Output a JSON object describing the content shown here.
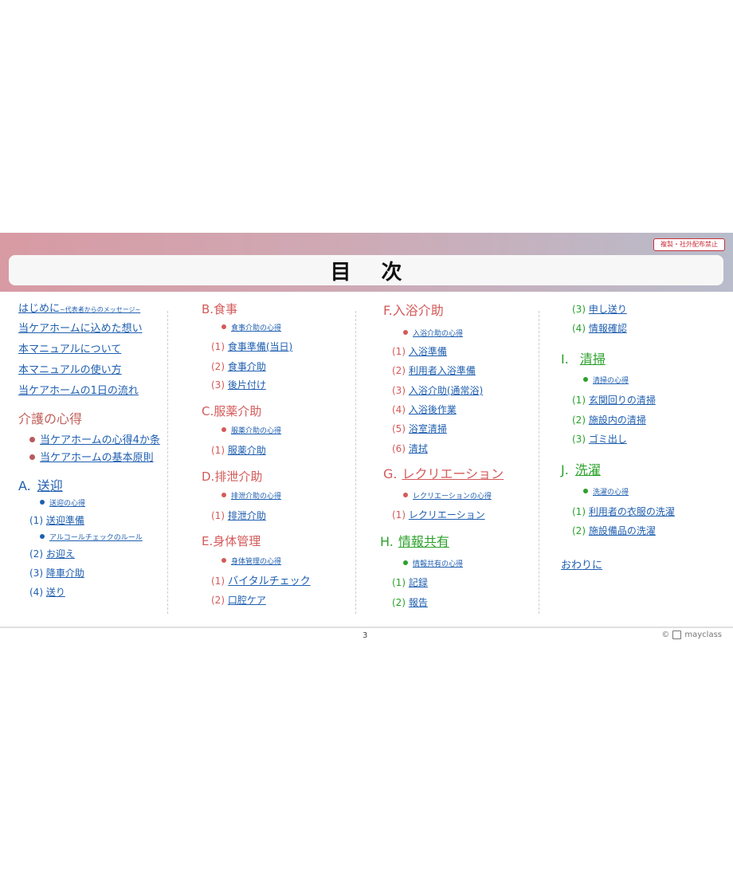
{
  "notice": "複製・社外配布禁止",
  "title": "目次",
  "col1": {
    "intro": "はじめに",
    "intro_sub": "~代表者からのメッセージ~",
    "links": [
      "当ケアホームに込めた想い",
      "本マニュアルについて",
      "本マニュアルの使い方",
      "当ケアホームの1日の流れ"
    ],
    "kaigo_title": "介護の心得",
    "kaigo_items": [
      "当ケアホームの心得4か条",
      "当ケアホームの基本原則"
    ],
    "a_letter": "A.",
    "a_title": "送迎",
    "a_heart": "送迎の心得",
    "a_1_num": "(1)",
    "a_1": "送迎準備",
    "a_alcohol": "アルコールチェックのルール",
    "a_2_num": "(2)",
    "a_2": "お迎え",
    "a_3_num": "(3)",
    "a_3": "降車介助",
    "a_4_num": "(4)",
    "a_4": "送り"
  },
  "col2": {
    "b_title": "B.食事",
    "b_heart": "食事介助の心得",
    "b_1_num": "(1)",
    "b_1": "食事準備(当日)",
    "b_2_num": "(2)",
    "b_2": "食事介助",
    "b_3_num": "(3)",
    "b_3": "後片付け",
    "c_title": "C.服薬介助",
    "c_heart": "服薬介助の心得",
    "c_1_num": "(1)",
    "c_1": "服薬介助",
    "d_title": "D.排泄介助",
    "d_heart": "排泄介助の心得",
    "d_1_num": "(1)",
    "d_1": "排泄介助",
    "e_title": "E.身体管理",
    "e_heart": "身体管理の心得",
    "e_1_num": "(1)",
    "e_1": "バイタルチェック",
    "e_2_num": "(2)",
    "e_2": "口腔ケア"
  },
  "col3": {
    "f_title": "F.入浴介助",
    "f_heart": "入浴介助の心得",
    "f_1_num": "(1)",
    "f_1": "入浴準備",
    "f_2_num": "(2)",
    "f_2": "利用者入浴準備",
    "f_3_num": "(3)",
    "f_3": "入浴介助(通常浴)",
    "f_4_num": "(4)",
    "f_4": "入浴後作業",
    "f_5_num": "(5)",
    "f_5": "浴室清掃",
    "f_6_num": "(6)",
    "f_6": "清拭",
    "g_letter": "G.",
    "g_title": "レクリエーション",
    "g_heart": "レクリエーションの心得",
    "g_1_num": "(1)",
    "g_1": "レクリエーション",
    "h_letter": "H.",
    "h_title": "情報共有",
    "h_heart": "情報共有の心得",
    "h_1_num": "(1)",
    "h_1": "記録",
    "h_2_num": "(2)",
    "h_2": "報告"
  },
  "col4": {
    "h_3_num": "(3)",
    "h_3": "申し送り",
    "h_4_num": "(4)",
    "h_4": "情報確認",
    "i_letter": "I.",
    "i_title": "清掃",
    "i_heart": "清掃の心得",
    "i_1_num": "(1)",
    "i_1": "玄関回りの清掃",
    "i_2_num": "(2)",
    "i_2": "施設内の清掃",
    "i_3_num": "(3)",
    "i_3": "ゴミ出し",
    "j_letter": "J.",
    "j_title": "洗濯",
    "j_heart": "洗濯の心得",
    "j_1_num": "(1)",
    "j_1": "利用者の衣服の洗濯",
    "j_2_num": "(2)",
    "j_2": "施設備品の洗濯",
    "end": "おわりに"
  },
  "footer": {
    "page": "3",
    "copyright": "©",
    "brand": "mayclass"
  },
  "colors": {
    "red": "#d45a5a",
    "blue": "#1f5fb0",
    "green": "#2aa12a",
    "kaigo": "#c0605a",
    "dot_kaigo": "#b85a5f"
  }
}
